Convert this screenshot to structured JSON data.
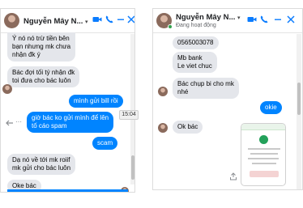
{
  "left_chat": {
    "header": {
      "name": "Nguyễn Mây N...",
      "chevron": "▾"
    },
    "header_icons": [
      "video-icon",
      "phone-icon",
      "minimize-icon",
      "close-icon"
    ],
    "messages": [
      {
        "side": "in",
        "lines": [
          "Ý nó nó trừ tiền bên",
          "bạn nhưng mk chưa",
          "nhận đk ý"
        ]
      },
      {
        "side": "in",
        "lines": [
          "Bác đợi tối tý nhận đk",
          "toi đưa cho bác luôn"
        ]
      },
      {
        "side": "out",
        "lines": [
          "mình gửi bill rồi"
        ]
      },
      {
        "side": "out",
        "lines": [
          "giờ bác ko gửi mình để lên",
          "tố cáo spam"
        ]
      },
      {
        "side": "out",
        "lines": [
          "scam"
        ]
      },
      {
        "side": "in",
        "lines": [
          "Dạ nó về tới mk roiif",
          "mk gửi cho bác luôn"
        ]
      },
      {
        "side": "in",
        "lines": [
          "Oke bác"
        ]
      }
    ],
    "tooltip_time": "15:04"
  },
  "right_chat": {
    "header": {
      "name": "Nguyễn Mây N...",
      "status": "Đang hoạt động",
      "chevron": "▾"
    },
    "header_icons": [
      "video-icon",
      "phone-icon",
      "minimize-icon",
      "close-icon"
    ],
    "messages": [
      {
        "side": "in",
        "lines": [
          "0565003078"
        ]
      },
      {
        "side": "in",
        "lines": [
          "Mb bank",
          "Le viet chuc"
        ]
      },
      {
        "side": "in",
        "lines": [
          "Bác chụp bi cho mk",
          "nhé"
        ]
      },
      {
        "side": "out",
        "lines": [
          "okie"
        ]
      },
      {
        "side": "in",
        "lines": [
          "Ok bác"
        ]
      }
    ]
  },
  "colors": {
    "messenger_blue": "#0084ff",
    "incoming_bubble": "#e4e6eb",
    "online_green": "#31a24c"
  }
}
